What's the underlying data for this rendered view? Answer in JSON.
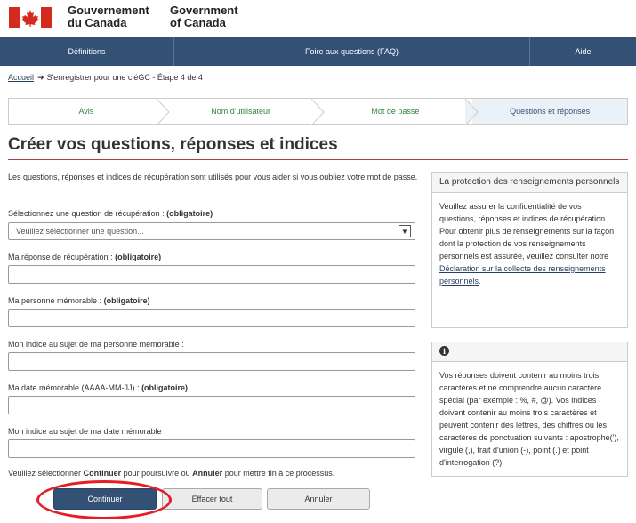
{
  "header": {
    "gov_fr": [
      "Gouvernement",
      "du Canada"
    ],
    "gov_en": [
      "Government",
      "of Canada"
    ],
    "flag_color": "#d52b1e"
  },
  "menu": [
    "Définitions",
    "Foire aux questions (FAQ)",
    "Aide"
  ],
  "breadcrumb": {
    "home": "Accueil",
    "current": "S'enregistrer pour une cléGC - Étape 4 de 4"
  },
  "steps": [
    "Avis",
    "Nom d'utilisateur",
    "Mot de passe",
    "Questions et réponses"
  ],
  "title": "Créer vos questions, réponses et indices",
  "intro": "Les questions, réponses et indices de récupération sont utilisés pour vous aider si vous oubliez votre mot de passe.",
  "fields": {
    "question": {
      "label": "Sélectionnez une question de récupération :",
      "required": "(obligatoire)",
      "value": "Veuillez sélectionner une question..."
    },
    "answer": {
      "label": "Ma réponse de récupération :",
      "required": "(obligatoire)"
    },
    "person": {
      "label": "Ma personne mémorable :",
      "required": "(obligatoire)"
    },
    "person_hint": {
      "label": "Mon indice au sujet de ma personne mémorable :"
    },
    "date": {
      "label": "Ma date mémorable (AAAA-MM-JJ) :",
      "required": "(obligatoire)"
    },
    "date_hint": {
      "label": "Mon indice au sujet de ma date mémorable :"
    }
  },
  "instructions": {
    "pre": "Veuillez sélectionner",
    "continue": "Continuer",
    "mid": "pour poursuivre ou",
    "cancel": "Annuler",
    "post": "pour mettre fin à ce processus."
  },
  "buttons": {
    "continue": "Continuer",
    "clear": "Effacer tout",
    "cancel": "Annuler"
  },
  "privacy_panel": {
    "heading": "La protection des renseignements personnels",
    "body": "Veuillez assurer la confidentialité de vos questions, réponses et indices de récupération. Pour obtenir plus de renseignements sur la façon dont la protection de vos renseignements personnels est assurée, veuillez consulter notre",
    "link": "Déclaration sur la collecte des renseignements personnels",
    "end": "."
  },
  "info_panel": {
    "icon": "i",
    "body": "Vos réponses doivent contenir au moins trois caractères et ne comprendre aucun caractère spécial (par exemple : %, #, @). Vos indices doivent contenir au moins trois caractères et peuvent contenir des lettres, des chiffres ou les caractères de ponctuation suivants : apostrophe('), virgule (,), trait d'union (-), point (.) et point d'interrogation (?)."
  }
}
